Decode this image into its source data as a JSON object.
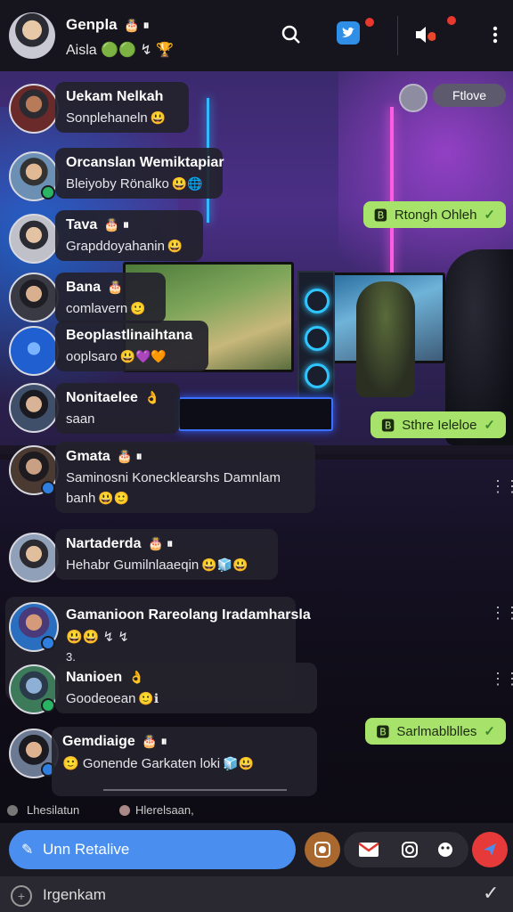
{
  "header": {
    "name": "Genpla",
    "name_emoji": "🎂 ⏸",
    "subtitle": "Aisla 🟢🟢 ↯ 🏆",
    "icons": [
      "search-icon",
      "twitter-icon",
      "speaker-icon",
      "more-vertical-icon"
    ]
  },
  "background": {
    "pill_label": "Ftlove"
  },
  "messages": [
    {
      "sender": "Uekam Nelkah",
      "text": "Sonplehaneln",
      "emoji": "😃"
    },
    {
      "sender": "Orcanslan Wemiktapiar",
      "text": "Bleiyoby Rönalko",
      "emoji": "😃🌐"
    },
    {
      "sender": "Tava",
      "sender_emoji": "🎂 ⏸",
      "text": "Grapddoyahanin",
      "emoji": "😃"
    },
    {
      "sender": "Bana",
      "sender_emoji": "🎂",
      "text": "comlavern",
      "emoji": "🙂"
    },
    {
      "sender": "Beoplastlinaihtana",
      "text": "ooplsaro",
      "emoji": "😃💜🧡"
    },
    {
      "sender": "Nonitaelee",
      "sender_emoji": "👌",
      "text": "saan"
    },
    {
      "sender": "Gmata",
      "sender_emoji": "🎂 ⏸",
      "text": "Saminosni Konecklearshs Damnlam",
      "text2": "banh",
      "emoji": "😃🙂"
    },
    {
      "sender": "Nartaderda",
      "sender_emoji": "🎂 ⏸",
      "text": "Hehabr Gumilnlaaeqin",
      "emoji": "😃🧊😃"
    },
    {
      "sender": "Gamanioon Rareolang Iradamharsla",
      "text": "😃😃 ↯ ↯",
      "text2": "3."
    },
    {
      "sender": "Nanioen",
      "sender_emoji": "👌",
      "text": "Goodeoean",
      "emoji": "🙂ℹ"
    },
    {
      "sender": "Gemdiaige",
      "sender_emoji": "🎂 ⏸",
      "text": "Gonende Garkaten loki",
      "pre_emoji": "🙂",
      "emoji": "🧊😃"
    }
  ],
  "outgoing": [
    {
      "text": "Rtongh Ohleh",
      "prefix": "🅱",
      "check": "✓"
    },
    {
      "text": "Sthre Ieleloe",
      "prefix": "🅱",
      "check": "✓"
    },
    {
      "text": "Sarlmablblles",
      "prefix": "🅱",
      "check": "✓"
    }
  ],
  "status": {
    "left": "Lhesilatun",
    "right": "Hlerelsaan,"
  },
  "composer": {
    "placeholder": "Unn Retalive"
  },
  "footer": {
    "label": "Irgenkam"
  },
  "colors": {
    "accent": "#4a8ff0",
    "outgoing": "#a7e36a",
    "header": "#16141c"
  }
}
